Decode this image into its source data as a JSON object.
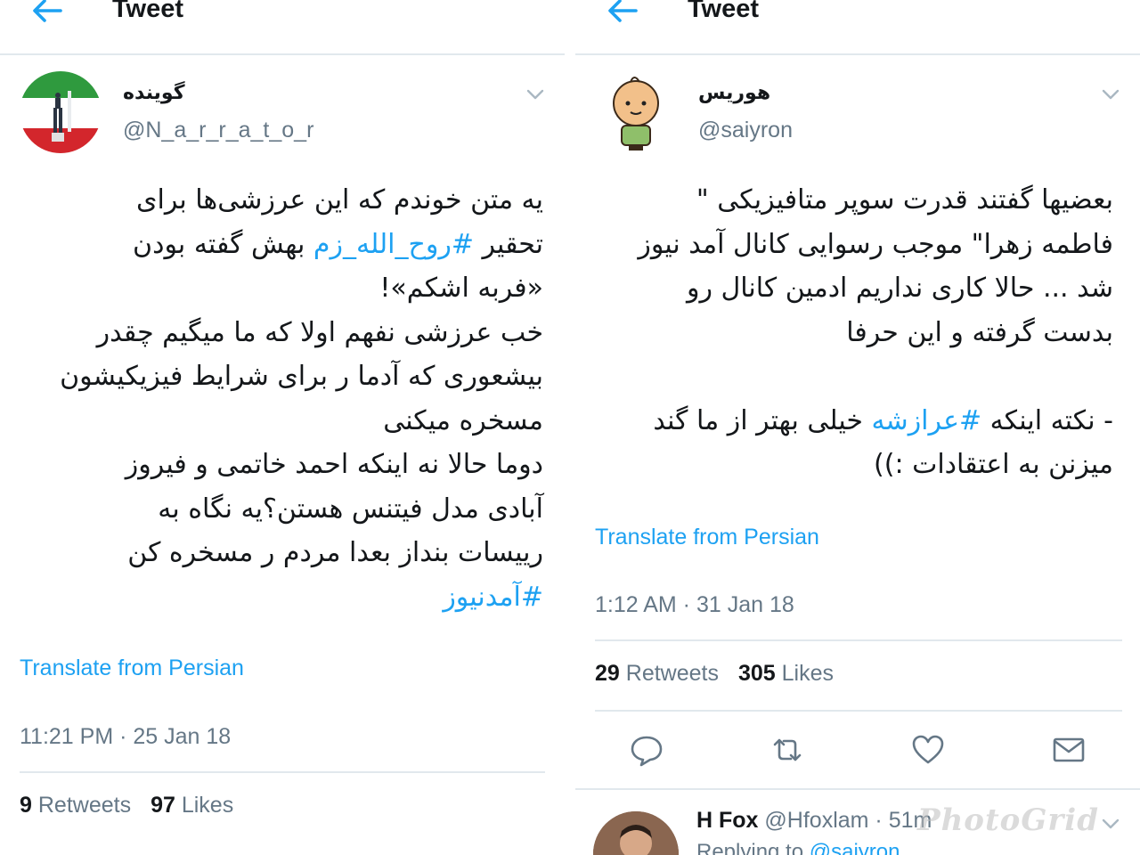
{
  "left": {
    "header": {
      "title": "Tweet"
    },
    "author": {
      "display_name": "گوینده",
      "handle": "@N_a_r_r_a_t_o_r"
    },
    "tweet": {
      "lines": [
        {
          "text": "یه متن خوندم که این عرزشی‌ها برای"
        },
        {
          "pre": "تحقیر ",
          "tag": "#روح_الله_زم",
          "post": " بهش گفته بودن"
        },
        {
          "text": "«فربه اشکم»!"
        },
        {
          "text": "خب عرزشی نفهم اولا که ما میگیم چقدر"
        },
        {
          "text": "بیشعوری که آدما ر برای شرایط فیزیکیشون"
        },
        {
          "text": "مسخره میکنی"
        },
        {
          "text": "دوما حالا نه اینکه احمد خاتمی و فیروز"
        },
        {
          "text": "آبادی مدل فیتنس هستن؟یه نگاه به"
        },
        {
          "text": "رییسات بنداز بعدا مردم ر مسخره کن"
        },
        {
          "tag": "#آمدنیوز"
        }
      ]
    },
    "translate_link": "Translate from Persian",
    "timestamp": "11:21 PM · 25 Jan 18",
    "stats": {
      "retweets_count": "9",
      "retweets_label": "Retweets",
      "likes_count": "97",
      "likes_label": "Likes"
    }
  },
  "right": {
    "header": {
      "title": "Tweet"
    },
    "author": {
      "display_name": "هوریس",
      "handle": "@saiyron"
    },
    "tweet": {
      "lines": [
        {
          "text": "بعضیها گفتند قدرت سوپر متافیزیکی \""
        },
        {
          "text": "فاطمه زهرا\" موجب رسوایی کانال آمد نیوز"
        },
        {
          "text": "شد ... حالا کاری نداریم ادمین کانال رو"
        },
        {
          "text": "بدست گرفته و این حرفا"
        },
        {
          "text": " "
        },
        {
          "pre": "- نکته اینکه ",
          "tag": "#عرازشه",
          "post": " خیلی بهتر از ما گند"
        },
        {
          "text": "میزنن به اعتقادات :))"
        }
      ]
    },
    "translate_link": "Translate from Persian",
    "timestamp": "1:12 AM · 31 Jan 18",
    "stats": {
      "retweets_count": "29",
      "retweets_label": "Retweets",
      "likes_count": "305",
      "likes_label": "Likes"
    },
    "actions": [
      "reply-icon",
      "retweet-icon",
      "like-icon",
      "direct-message-icon"
    ],
    "reply": {
      "name": "H Fox",
      "handle_time": "@Hfoxlam · 51m",
      "replying_prefix": "Replying to",
      "replying_handle": "@saiyron"
    },
    "watermark": "PhotoGrid"
  },
  "colors": {
    "accent": "#1da1f2",
    "text": "#14171a",
    "muted": "#657786",
    "divider": "#e1e8ed"
  }
}
